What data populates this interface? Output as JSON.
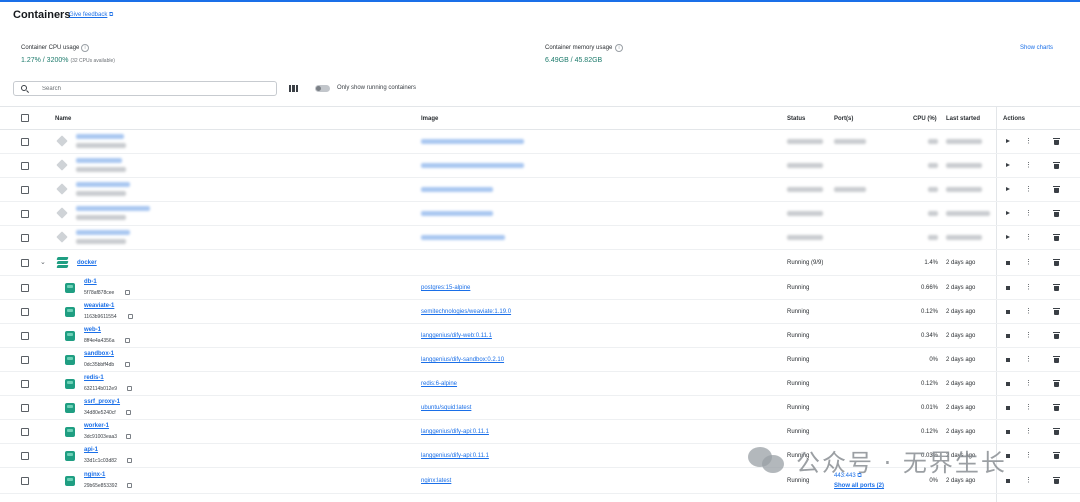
{
  "header": {
    "title": "Containers",
    "feedback_label": "Give feedback",
    "feedback_icon": "external-feedback-icon"
  },
  "stats": {
    "cpu_label": "Container CPU usage",
    "cpu_value": "1.27% / 3200%",
    "cpu_sub": "(32 CPUs available)",
    "memory_label": "Container memory usage",
    "memory_value": "6.49GB / 45.82GB",
    "show_charts": "Show charts"
  },
  "toolbar": {
    "search_placeholder": "Search",
    "running_only_label": "Only show running containers"
  },
  "columns": {
    "name": "Name",
    "image": "Image",
    "status": "Status",
    "ports": "Port(s)",
    "cpu": "CPU (%)",
    "last_started": "Last started",
    "actions": "Actions"
  },
  "group": {
    "name": "docker",
    "status": "Running (9/9)",
    "cpu": "1.4%",
    "last_started": "2 days ago"
  },
  "containers": [
    {
      "name": "db-1",
      "id": "5f78af878cee",
      "image": "postgres:15-alpine",
      "status": "Running",
      "cpu": "0.66%",
      "last_started": "2 days ago"
    },
    {
      "name": "weaviate-1",
      "id": "1163b9611554",
      "image": "semitechnologies/weaviate:1.19.0",
      "status": "Running",
      "cpu": "0.12%",
      "last_started": "2 days ago"
    },
    {
      "name": "web-1",
      "id": "8ff4e4a4356a",
      "image": "langgenius/dify-web:0.11.1",
      "status": "Running",
      "cpu": "0.34%",
      "last_started": "2 days ago"
    },
    {
      "name": "sandbox-1",
      "id": "0dc35bbff4db",
      "image": "langgenius/dify-sandbox:0.2.10",
      "status": "Running",
      "cpu": "0%",
      "last_started": "2 days ago"
    },
    {
      "name": "redis-1",
      "id": "632114b012e9",
      "image": "redis:6-alpine",
      "status": "Running",
      "cpu": "0.12%",
      "last_started": "2 days ago"
    },
    {
      "name": "ssrf_proxy-1",
      "id": "34d80e5240cf",
      "image": "ubuntu/squid:latest",
      "status": "Running",
      "cpu": "0.01%",
      "last_started": "2 days ago"
    },
    {
      "name": "worker-1",
      "id": "3dc91003eaa3",
      "image": "langgenius/dify-api:0.11.1",
      "status": "Running",
      "cpu": "0.12%",
      "last_started": "2 days ago"
    },
    {
      "name": "api-1",
      "id": "33d1c1c03d82",
      "image": "langgenius/dify-api:0.11.1",
      "status": "Running",
      "cpu": "0.03%",
      "last_started": "2 days ago"
    },
    {
      "name": "nginx-1",
      "id": "29b65e853392",
      "image": "nginx:latest",
      "status": "Running",
      "cpu": "0%",
      "last_started": "2 days ago",
      "port": "443:443",
      "show_all_ports": "Show all ports (2)"
    }
  ],
  "watermark": {
    "text": "公众号 · 无界生长",
    "logo": "wechat-logo"
  }
}
